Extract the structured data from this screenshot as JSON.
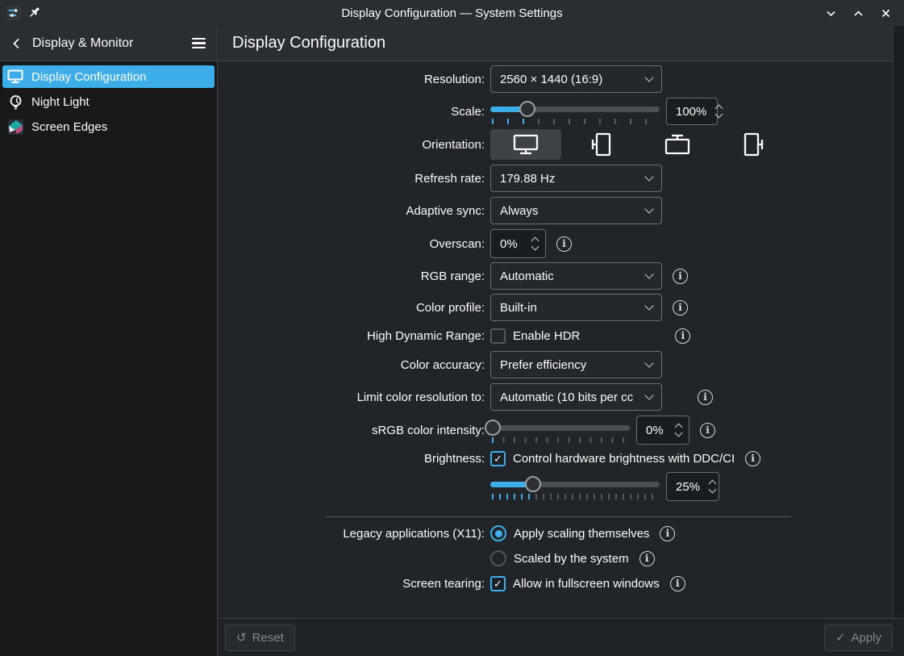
{
  "colors": {
    "accent": "#3daee9",
    "titlebar_bg": "#2a2e33",
    "sidebar_bg": "#17191b",
    "content_bg": "#212529",
    "screen_edges_teal": "#1ca9a0",
    "screen_edges_magenta": "#b54a7e"
  },
  "icons": {
    "info": "i",
    "check": "✓",
    "reset": "↺",
    "apply": "✓"
  },
  "titlebar": {
    "title": "Display Configuration — System Settings"
  },
  "sidebar": {
    "header": {
      "title": "Display & Monitor"
    },
    "items": [
      {
        "label": "Display Configuration",
        "selected": true
      },
      {
        "label": "Night Light",
        "selected": false
      },
      {
        "label": "Screen Edges",
        "selected": false
      }
    ]
  },
  "page": {
    "title": "Display Configuration"
  },
  "form": {
    "resolution": {
      "label": "Resolution:",
      "value": "2560 × 1440 (16:9)"
    },
    "scale": {
      "label": "Scale:",
      "value": "100%",
      "slider": {
        "percent": 22,
        "tick_step": 19
      }
    },
    "orientation": {
      "label": "Orientation:",
      "selected": "landscape",
      "options": [
        "landscape",
        "portrait",
        "landscape-flipped",
        "portrait-flipped"
      ]
    },
    "refresh_rate": {
      "label": "Refresh rate:",
      "value": "179.88 Hz"
    },
    "adaptive_sync": {
      "label": "Adaptive sync:",
      "value": "Always"
    },
    "overscan": {
      "label": "Overscan:",
      "value": "0%"
    },
    "rgb_range": {
      "label": "RGB range:",
      "value": "Automatic"
    },
    "color_profile": {
      "label": "Color profile:",
      "value": "Built-in"
    },
    "hdr": {
      "label": "High Dynamic Range:",
      "checkbox_label": "Enable HDR",
      "checked": false
    },
    "color_accuracy": {
      "label": "Color accuracy:",
      "value": "Prefer efficiency"
    },
    "limit_color_resolution": {
      "label": "Limit color resolution to:",
      "value": "Automatic  (10 bits per cc"
    },
    "srgb_intensity": {
      "label": "sRGB color intensity:",
      "value": "0%",
      "slider": {
        "percent": 2,
        "tick_step": 13.5
      }
    },
    "brightness": {
      "label": "Brightness:",
      "checkbox_label": "Control hardware brightness with DDC/CI",
      "checked": true,
      "value": "25%",
      "slider": {
        "percent": 25,
        "tick_step": 9
      }
    },
    "legacy_apps": {
      "label": "Legacy applications (X11):",
      "options": [
        {
          "label": "Apply scaling themselves",
          "selected": true
        },
        {
          "label": "Scaled by the system",
          "selected": false
        }
      ]
    },
    "screen_tearing": {
      "label": "Screen tearing:",
      "checkbox_label": "Allow in fullscreen windows",
      "checked": true
    }
  },
  "footer": {
    "reset_label": "Reset",
    "apply_label": "Apply"
  }
}
